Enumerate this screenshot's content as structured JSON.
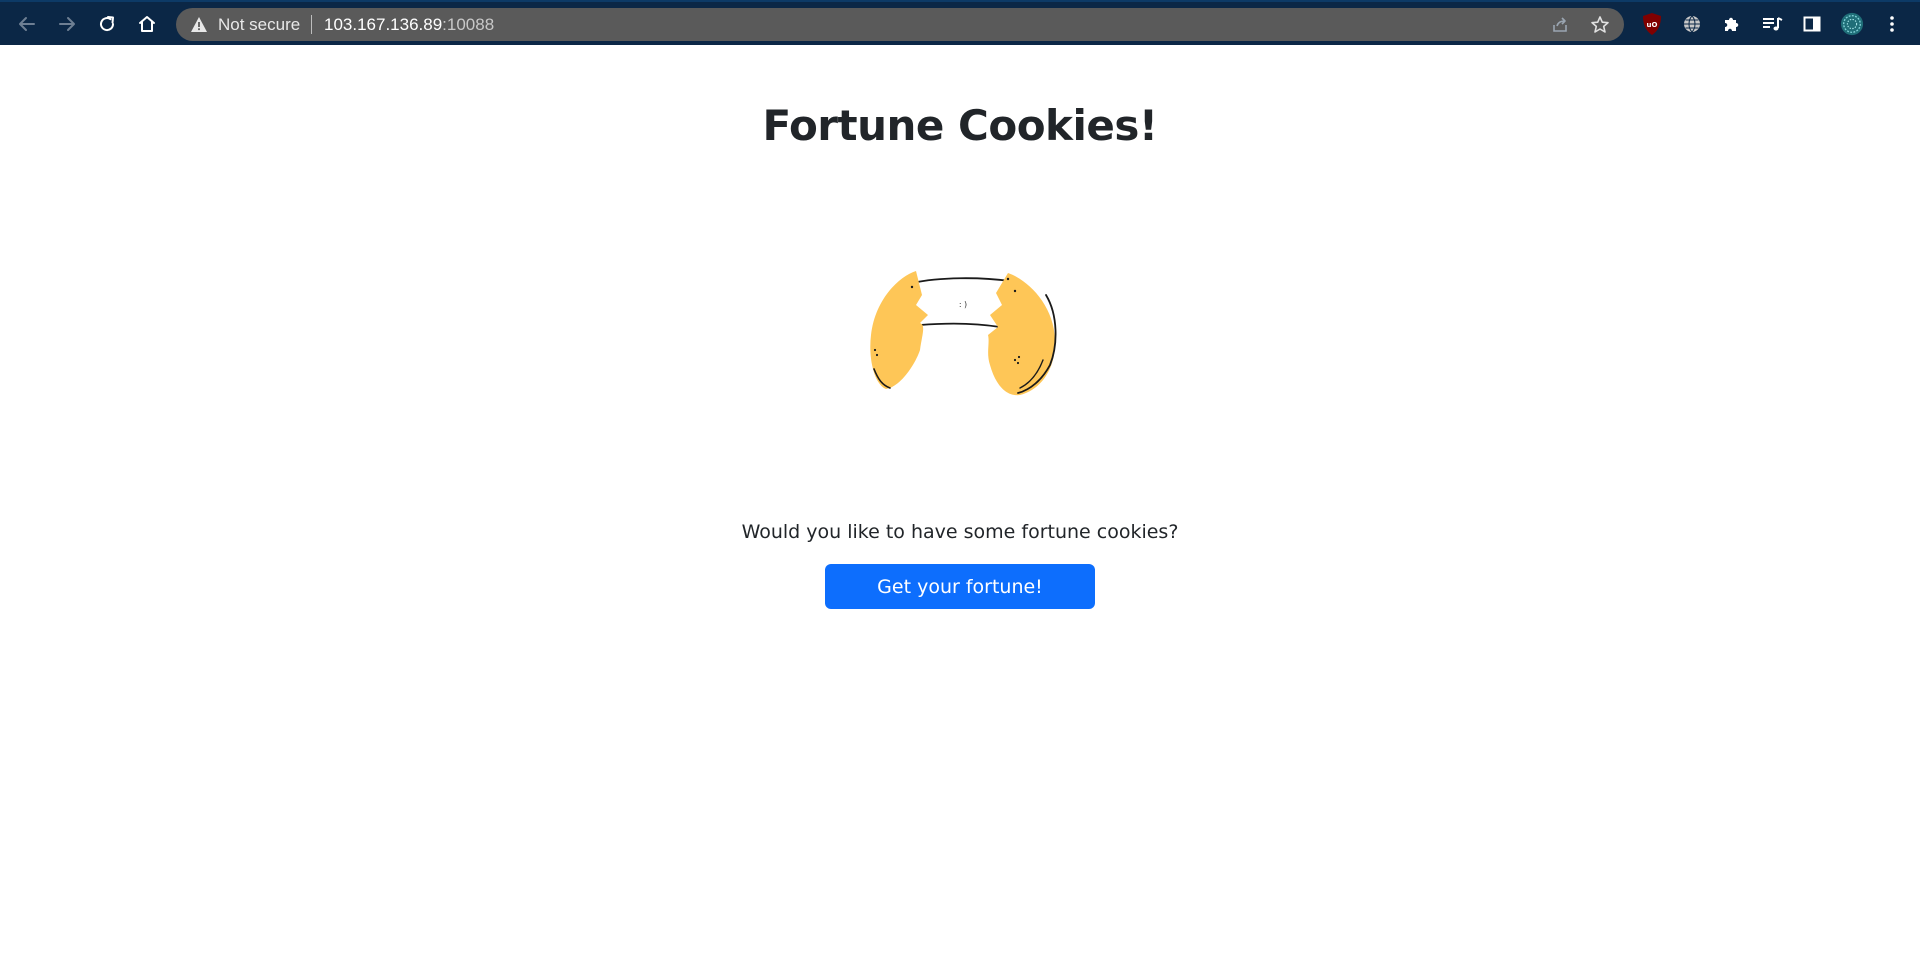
{
  "browser": {
    "security_label": "Not secure",
    "url_host": "103.167.136.89",
    "url_port": ":10088",
    "icons": {
      "back": "back-arrow-icon",
      "forward": "forward-arrow-icon",
      "reload": "reload-icon",
      "home": "home-icon",
      "warning": "warning-triangle-icon",
      "share": "share-icon",
      "bookmark": "star-icon",
      "ublock": "ublock-shield-icon",
      "globe": "globe-icon",
      "extensions": "puzzle-icon",
      "media": "playlist-icon",
      "side_panel": "side-panel-icon",
      "profile": "avatar-icon",
      "menu": "kebab-menu-icon"
    }
  },
  "page": {
    "title": "Fortune Cookies!",
    "cookie_message": ": )",
    "prompt": "Would you like to have some fortune cookies?",
    "button_label": "Get your fortune!"
  },
  "colors": {
    "toolbar": "#0b2746",
    "omnibox": "#5a5a5a",
    "button": "#0d6efd",
    "cookie": "#fec657",
    "text": "#212529"
  }
}
